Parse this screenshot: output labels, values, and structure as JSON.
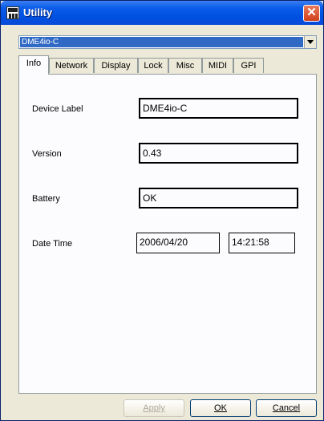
{
  "window": {
    "title": "Utility",
    "close_glyph": "✕",
    "icon": "dme-app-icon"
  },
  "device_select": {
    "value": "DME4io-C"
  },
  "tabs": [
    {
      "label": "Info",
      "active": true
    },
    {
      "label": "Network",
      "active": false
    },
    {
      "label": "Display",
      "active": false
    },
    {
      "label": "Lock",
      "active": false
    },
    {
      "label": "Misc",
      "active": false
    },
    {
      "label": "MIDI",
      "active": false
    },
    {
      "label": "GPI",
      "active": false
    }
  ],
  "info": {
    "device_label": {
      "label": "Device Label",
      "value": "DME4io-C"
    },
    "version": {
      "label": "Version",
      "value": "0.43"
    },
    "battery": {
      "label": "Battery",
      "value": "OK"
    },
    "date_time": {
      "label": "Date Time",
      "date": "2006/04/20",
      "time": "14:21:58"
    }
  },
  "buttons": {
    "apply": {
      "label": "Apply",
      "enabled": false
    },
    "ok": {
      "label": "OK"
    },
    "cancel": {
      "label": "Cancel"
    }
  }
}
